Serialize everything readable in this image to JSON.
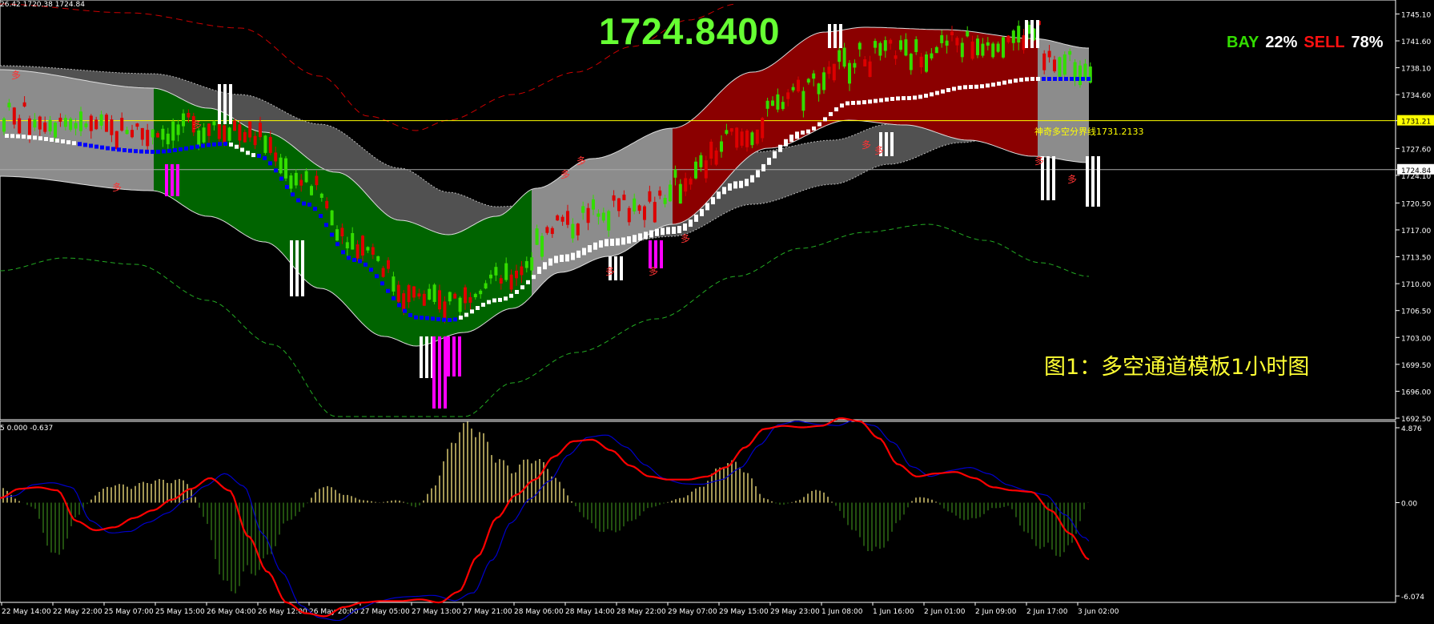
{
  "header": {
    "ohlc_text": "26.42 1720.38 1724.84",
    "big_price": "1724.8400",
    "bay_label": "BAY",
    "bay_pct": "22%",
    "sell_label": "SELL",
    "sell_pct": "78%",
    "caption": "图1：多空通道模板1小时图",
    "boundary_label": "神奇多空分界线1731.2133"
  },
  "colors": {
    "background": "#000000",
    "bull_candle": "#33dd00",
    "bear_candle": "#dd0000",
    "green_channel": "#006400",
    "red_channel": "#8b0000",
    "gray_channel": "#8c8c8c",
    "blue_dot": "#0000ff",
    "white_dot": "#ffffff",
    "macd_line": "#ff0000",
    "signal_line": "#0000cc",
    "hist_pos": "#d8c870",
    "hist_neg": "#2e6b14",
    "yellow_line": "#ffff00",
    "bay_green": "#33dd00",
    "sell_red": "#ff1111",
    "big_price": "#66ff33"
  },
  "chart_data": [
    {
      "type": "candlestick",
      "title": "",
      "price_axis": [
        "1745.10",
        "1741.60",
        "1738.10",
        "1734.60",
        "1731.21",
        "1727.60",
        "1724.84",
        "1724.10",
        "1720.50",
        "1717.00",
        "1713.50",
        "1710.00",
        "1706.50",
        "1703.00",
        "1699.50",
        "1696.00",
        "1692.50"
      ],
      "ylim": [
        1692.5,
        1746.5
      ],
      "current_price": 1724.84,
      "boundary_price": 1731.21,
      "time_axis": [
        "22 May 14:00",
        "22 May 22:00",
        "25 May 07:00",
        "25 May 15:00",
        "26 May 04:00",
        "26 May 12:00",
        "26 May 20:00",
        "27 May 05:00",
        "27 May 13:00",
        "27 May 21:00",
        "28 May 06:00",
        "28 May 14:00",
        "28 May 22:00",
        "29 May 07:00",
        "29 May 15:00",
        "29 May 23:00",
        "1 Jun 08:00",
        "1 Jun 16:00",
        "2 Jun 01:00",
        "2 Jun 09:00",
        "2 Jun 17:00",
        "3 Jun 02:00"
      ],
      "marker_char": "多",
      "marker_count": 12
    },
    {
      "type": "macd",
      "header": "5 0.000 -0.637",
      "axis": [
        "4.876",
        "0.00",
        "-6.074"
      ],
      "ylim": [
        -6.074,
        4.876
      ],
      "macd_points": [
        0.3,
        0.9,
        1.0,
        0.8,
        -1.2,
        -1.8,
        -1.6,
        -1.0,
        -0.5,
        0.2,
        0.9,
        1.6,
        0.8,
        -2.2,
        -4.5,
        -6.5,
        -7.2,
        -7.4,
        -6.8,
        -6.5,
        -6.4,
        -6.4,
        -6.3,
        -6.5,
        -5.8,
        -3.5,
        -1.0,
        0.5,
        1.5,
        3.0,
        4.0,
        4.1,
        3.4,
        2.4,
        1.7,
        1.5,
        1.5,
        1.7,
        2.3,
        3.6,
        4.8,
        5.0,
        4.9,
        5.0,
        5.5,
        5.3,
        4.2,
        2.5,
        1.7,
        1.9,
        2.0,
        1.6,
        1.0,
        0.8,
        0.7,
        -0.5,
        -2.0,
        -3.7
      ]
    }
  ]
}
